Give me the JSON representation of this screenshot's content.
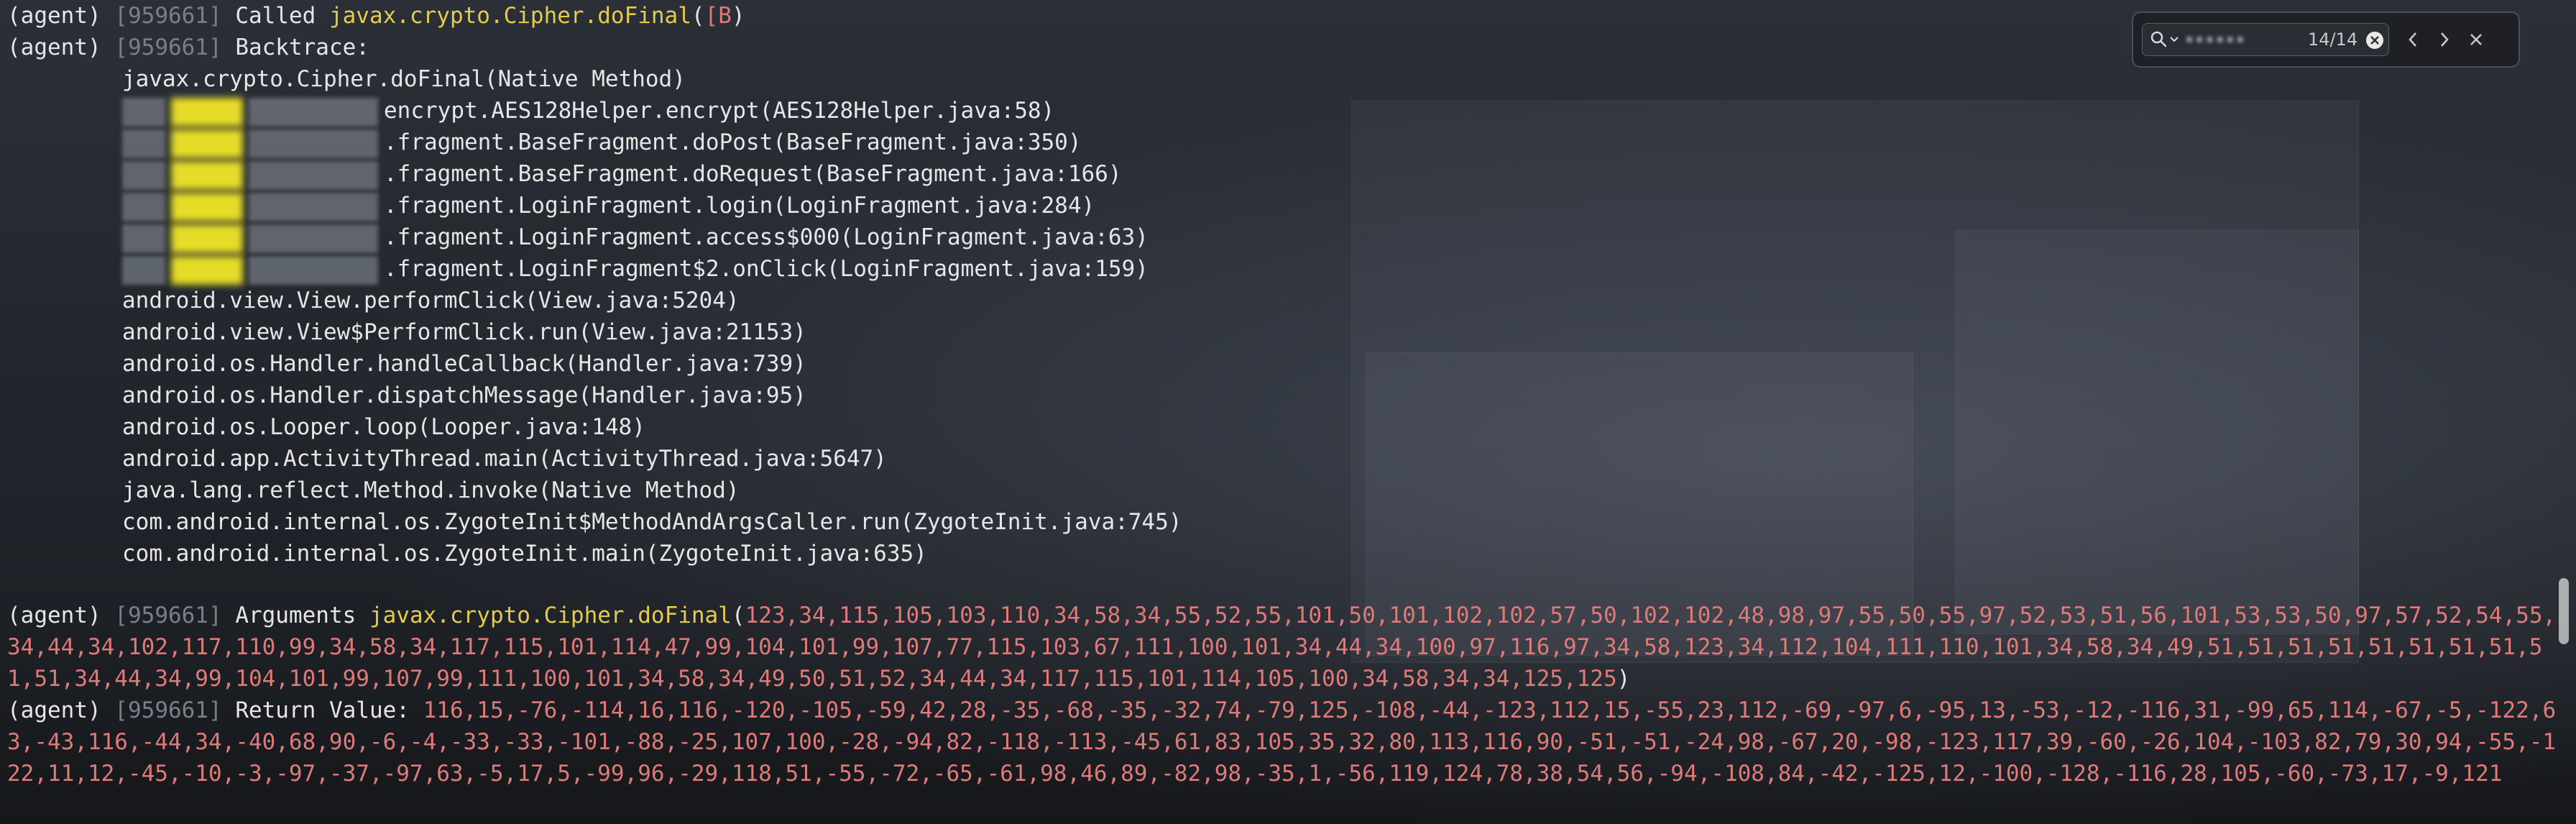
{
  "colors": {
    "background": "#1d2025",
    "text": "#e6e6e6",
    "pid": "#7a7f87",
    "method_yellow": "#e5cb4a",
    "value_red": "#e07a78"
  },
  "terminal": {
    "call_line": {
      "prefix": "(agent)",
      "pid": "[959661]",
      "label": "Called",
      "method": "javax.crypto.Cipher.doFinal",
      "open": "(",
      "arg": "[B",
      "close": ")"
    },
    "backtrace_line": {
      "prefix": "(agent)",
      "pid": "[959661]",
      "label": "Backtrace:"
    },
    "frames": [
      "javax.crypto.Cipher.doFinal(Native Method)"
    ],
    "redacted_frames": [
      "encrypt.AES128Helper.encrypt(AES128Helper.java:58)",
      ".fragment.BaseFragment.doPost(BaseFragment.java:350)",
      ".fragment.BaseFragment.doRequest(BaseFragment.java:166)",
      ".fragment.LoginFragment.login(LoginFragment.java:284)",
      ".fragment.LoginFragment.access$000(LoginFragment.java:63)",
      ".fragment.LoginFragment$2.onClick(LoginFragment.java:159)"
    ],
    "frames_after": [
      "android.view.View.performClick(View.java:5204)",
      "android.view.View$PerformClick.run(View.java:21153)",
      "android.os.Handler.handleCallback(Handler.java:739)",
      "android.os.Handler.dispatchMessage(Handler.java:95)",
      "android.os.Looper.loop(Looper.java:148)",
      "android.app.ActivityThread.main(ActivityThread.java:5647)",
      "java.lang.reflect.Method.invoke(Native Method)",
      "com.android.internal.os.ZygoteInit$MethodAndArgsCaller.run(ZygoteInit.java:745)",
      "com.android.internal.os.ZygoteInit.main(ZygoteInit.java:635)"
    ],
    "arguments_line": {
      "prefix": "(agent)",
      "pid": "[959661]",
      "label": "Arguments",
      "method": "javax.crypto.Cipher.doFinal",
      "open": "(",
      "values": "123,34,115,105,103,110,34,58,34,55,52,55,101,50,101,102,102,57,50,102,102,48,98,97,55,50,55,97,52,53,51,56,101,53,53,50,97,57,52,54,55,34,44,34,102,117,110,99,34,58,34,117,115,101,114,47,99,104,101,99,107,77,115,103,67,111,100,101,34,44,34,100,97,116,97,34,58,123,34,112,104,111,110,101,34,58,34,49,51,51,51,51,51,51,51,51,51,51,34,44,34,99,104,101,99,107,99,111,100,101,34,58,34,49,50,51,52,34,44,34,117,115,101,114,105,100,34,58,34,34,125,125",
      "close": ")"
    },
    "return_line": {
      "prefix": "(agent)",
      "pid": "[959661]",
      "label": "Return Value:",
      "values": "116,15,-76,-114,16,116,-120,-105,-59,42,28,-35,-68,-35,-32,74,-79,125,-108,-44,-123,112,15,-55,23,112,-69,-97,6,-95,13,-53,-12,-116,31,-99,65,114,-67,-5,-122,63,-43,116,-44,34,-40,68,90,-6,-4,-33,-33,-101,-88,-25,107,100,-28,-94,82,-118,-113,-45,61,83,105,35,32,80,113,116,90,-51,-51,-24,98,-67,20,-98,-123,117,39,-60,-26,104,-103,82,79,30,94,-55,-122,11,12,-45,-10,-3,-97,-37,-97,63,-5,17,5,-99,96,-29,118,51,-55,-72,-65,-61,98,46,89,-82,98,-35,1,-56,119,124,78,38,54,56,-94,-108,84,-42,-125,12,-100,-128,-116,28,105,-60,-73,17,-9,121"
    }
  },
  "search": {
    "match_count": "14/14",
    "input_value": "••••••",
    "icons": [
      "search-icon",
      "clear-icon",
      "previous-match-icon",
      "next-match-icon",
      "close-icon"
    ]
  }
}
